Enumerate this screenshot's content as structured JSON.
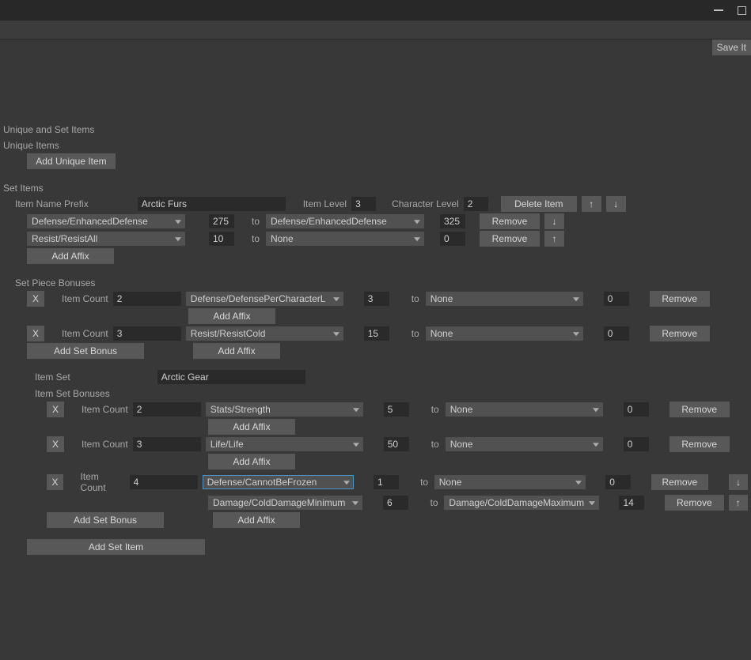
{
  "titlebar": {
    "minimize": "–",
    "maximize": "▢"
  },
  "toolbar": {
    "save": "Save It"
  },
  "headings": {
    "uniqueSet": "Unique and Set Items",
    "unique": "Unique Items",
    "setItems": "Set Items",
    "setPieceBonuses": "Set Piece Bonuses",
    "itemSet": "Item Set",
    "itemSetBonuses": "Item Set Bonuses"
  },
  "labels": {
    "addUnique": "Add Unique Item",
    "itemNamePrefix": "Item Name Prefix",
    "itemLevel": "Item Level",
    "characterLevel": "Character Level",
    "deleteItem": "Delete Item",
    "to": "to",
    "remove": "Remove",
    "addAffix": "Add Affix",
    "itemCount": "Item Count",
    "x": "X",
    "addSetBonus": "Add Set Bonus",
    "addSetItem": "Add Set Item",
    "up": "↑",
    "down": "↓"
  },
  "setItem": {
    "namePrefix": "Arctic Furs",
    "itemLevel": "3",
    "characterLevel": "2",
    "affixes": [
      {
        "left": "Defense/EnhancedDefense",
        "leftVal": "275",
        "right": "Defense/EnhancedDefense",
        "rightVal": "325",
        "hasUp": false,
        "hasDown": true
      },
      {
        "left": "Resist/ResistAll",
        "leftVal": "10",
        "right": "None",
        "rightVal": "0",
        "hasUp": true,
        "hasDown": false
      }
    ]
  },
  "setPieceBonuses": [
    {
      "itemCount": "2",
      "affixes": [
        {
          "left": "Defense/DefensePerCharacterL",
          "leftVal": "3",
          "right": "None",
          "rightVal": "0"
        }
      ]
    },
    {
      "itemCount": "3",
      "affixes": [
        {
          "left": "Resist/ResistCold",
          "leftVal": "15",
          "right": "None",
          "rightVal": "0"
        }
      ]
    }
  ],
  "itemSet": {
    "name": "Arctic Gear",
    "bonuses": [
      {
        "itemCount": "2",
        "affixes": [
          {
            "left": "Stats/Strength",
            "leftVal": "5",
            "right": "None",
            "rightVal": "0",
            "hasUp": false,
            "hasDown": false
          }
        ]
      },
      {
        "itemCount": "3",
        "affixes": [
          {
            "left": "Life/Life",
            "leftVal": "50",
            "right": "None",
            "rightVal": "0",
            "hasUp": false,
            "hasDown": false
          }
        ]
      },
      {
        "itemCount": "4",
        "affixes": [
          {
            "left": "Defense/CannotBeFrozen",
            "leftVal": "1",
            "right": "None",
            "rightVal": "0",
            "selected": true,
            "hasUp": false,
            "hasDown": true
          },
          {
            "left": "Damage/ColdDamageMinimum",
            "leftVal": "6",
            "right": "Damage/ColdDamageMaximum",
            "rightVal": "14",
            "hasUp": true,
            "hasDown": false
          }
        ]
      }
    ]
  }
}
